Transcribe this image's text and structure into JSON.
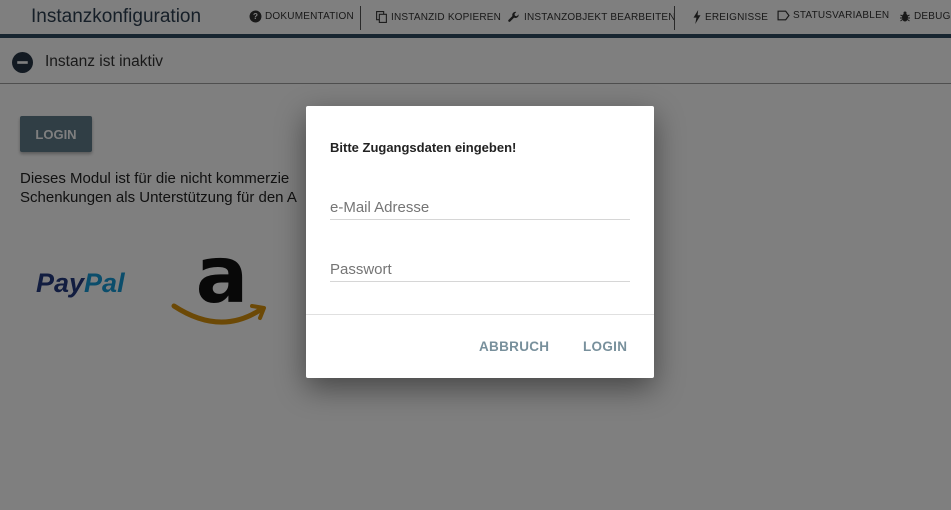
{
  "topbar": {
    "title": "Instanzkonfiguration",
    "items": [
      {
        "label": "DOKUMENTATION",
        "icon": "help-icon"
      },
      {
        "label": "INSTANZID KOPIEREN",
        "icon": "copy-icon"
      },
      {
        "label": "INSTANZOBJEKT BEARBEITEN",
        "icon": "wrench-icon"
      },
      {
        "label": "EREIGNISSE",
        "icon": "bolt-icon"
      },
      {
        "label": "STATUSVARIABLEN",
        "icon": "label-icon"
      },
      {
        "label": "DEBUG",
        "icon": "bug-icon"
      }
    ],
    "accent_color": "#2e4a60"
  },
  "status": {
    "text": "Instanz ist inaktiv",
    "icon": "minus-circle-icon"
  },
  "page": {
    "login_button": "LOGIN",
    "description_line1": "Dieses Modul ist für die nicht kommerzie",
    "description_line2": "Schenkungen als Unterstützung für den A",
    "paypal_pay": "Pay",
    "paypal_pal": "Pal",
    "amazon_letter": "a"
  },
  "dialog": {
    "title": "Bitte Zugangsdaten eingeben!",
    "email_placeholder": "e-Mail Adresse",
    "password_placeholder": "Passwort",
    "cancel_label": "ABBRUCH",
    "login_label": "LOGIN",
    "button_color": "#78909c"
  }
}
